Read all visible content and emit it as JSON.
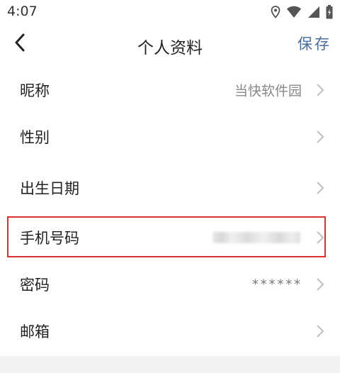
{
  "status_bar": {
    "time": "4:07",
    "icons": [
      "location-icon",
      "wifi-icon",
      "signal-icon",
      "battery-icon"
    ]
  },
  "nav": {
    "title": "个人资料",
    "save_label": "保存",
    "back_icon": "chevron-left-icon"
  },
  "rows": [
    {
      "label": "昵称",
      "value": "当快软件园"
    },
    {
      "label": "性别",
      "value": ""
    },
    {
      "label": "出生日期",
      "value": ""
    },
    {
      "label": "手机号码",
      "value": ""
    },
    {
      "label": "密码",
      "value": "******"
    },
    {
      "label": "邮箱",
      "value": ""
    }
  ],
  "colors": {
    "accent": "#4a6ea0",
    "highlight": "#e03030",
    "background": "#f2f2f2"
  }
}
